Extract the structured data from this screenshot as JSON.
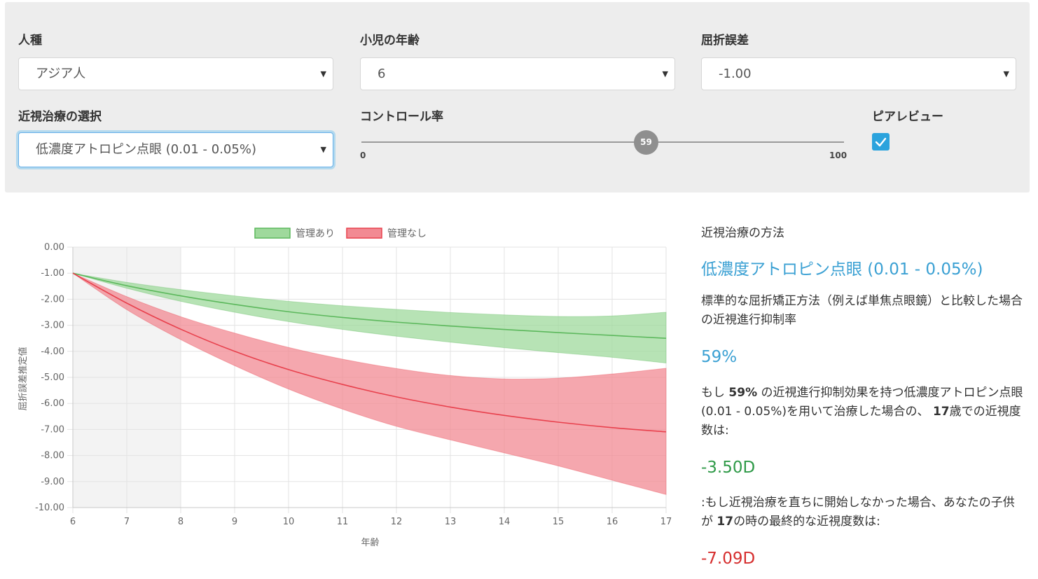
{
  "controls": {
    "race": {
      "label": "人種",
      "value": "アジア人"
    },
    "age": {
      "label": "小児の年齢",
      "value": "6"
    },
    "refraction": {
      "label": "屈折誤差",
      "value": "-1.00"
    },
    "treatment": {
      "label": "近視治療の選択",
      "value": "低濃度アトロピン点眼 (0.01 - 0.05%)"
    },
    "control_rate": {
      "label": "コントロール率",
      "value": "59",
      "min": "0",
      "max": "100",
      "fraction": 0.59
    },
    "peer_review": {
      "label": "ピアレビュー",
      "checked": true
    }
  },
  "side": {
    "title": "近視治療の方法",
    "method": "低濃度アトロピン点眼 (0.01 - 0.05%)",
    "description": "標準的な屈折矯正方法（例えば単焦点眼鏡）と比較した場合の近視進行抑制率",
    "rate": "59%",
    "p1": {
      "a": "もし ",
      "b": "59%",
      "c": " の近視進行抑制効果を持つ低濃度アトロピン点眼 (0.01 - 0.05%)を用いて治療した場合の、 ",
      "d": "17",
      "e": "歳での近視度数は:"
    },
    "result_with": "-3.50D",
    "p2": {
      "a": ":もし近視治療を直ちに開始しなかった場合、あなたの子供が ",
      "b": "17",
      "c": "の時の最終的な近視度数は:"
    },
    "result_without": "-7.09D"
  },
  "chart_data": {
    "type": "area",
    "x": [
      6,
      7,
      8,
      9,
      10,
      11,
      12,
      13,
      14,
      15,
      16,
      17
    ],
    "xlabel": "年齢",
    "ylabel": "屈折誤差推定値",
    "ylim": [
      -10,
      0
    ],
    "yticks": [
      "0.00",
      "-1.00",
      "-2.00",
      "-3.00",
      "-4.00",
      "-5.00",
      "-6.00",
      "-7.00",
      "-8.00",
      "-9.00",
      "-10.00"
    ],
    "grid": true,
    "legend": "top",
    "shaded_x_range": [
      6,
      8
    ],
    "series": [
      {
        "name": "管理あり",
        "color": "#5cb85c",
        "fill": "#9fd99c",
        "values": [
          -1.0,
          -1.48,
          -1.87,
          -2.2,
          -2.48,
          -2.7,
          -2.88,
          -3.03,
          -3.16,
          -3.28,
          -3.39,
          -3.5
        ],
        "upper": [
          -1.0,
          -1.35,
          -1.63,
          -1.87,
          -2.08,
          -2.25,
          -2.39,
          -2.51,
          -2.6,
          -2.66,
          -2.64,
          -2.5
        ],
        "lower": [
          -1.0,
          -1.58,
          -2.08,
          -2.5,
          -2.86,
          -3.16,
          -3.42,
          -3.65,
          -3.86,
          -4.05,
          -4.23,
          -4.45
        ]
      },
      {
        "name": "管理なし",
        "color": "#e8414d",
        "fill": "#f28a93",
        "values": [
          -1.0,
          -2.15,
          -3.15,
          -4.0,
          -4.7,
          -5.27,
          -5.75,
          -6.14,
          -6.46,
          -6.72,
          -6.93,
          -7.09
        ],
        "upper": [
          -1.0,
          -1.9,
          -2.67,
          -3.3,
          -3.85,
          -4.3,
          -4.66,
          -4.93,
          -5.06,
          -5.03,
          -4.87,
          -4.65
        ],
        "lower": [
          -1.0,
          -2.4,
          -3.55,
          -4.55,
          -5.45,
          -6.22,
          -6.88,
          -7.4,
          -7.9,
          -8.4,
          -8.95,
          -9.5
        ]
      }
    ]
  }
}
